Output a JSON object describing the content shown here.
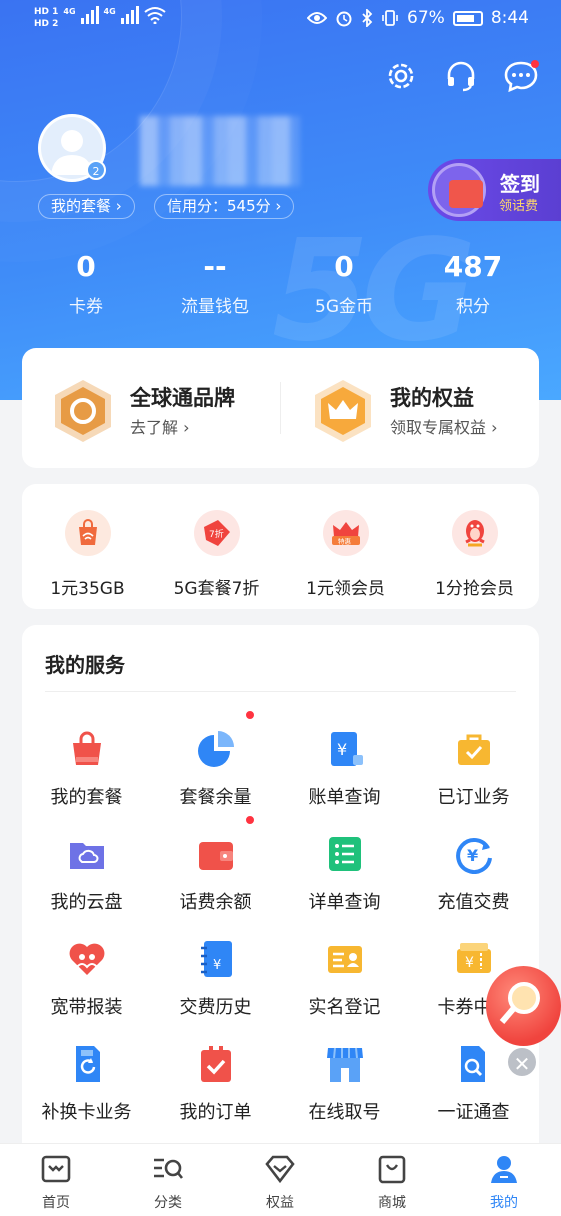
{
  "status_bar": {
    "hd1": "HD 1",
    "hd2": "HD 2",
    "net1": "4G",
    "net2": "4G",
    "battery": "67%",
    "time": "8:44"
  },
  "profile": {
    "level": "2",
    "plan_chip": "我的套餐 ›",
    "credit_chip": "信用分：545分 ›"
  },
  "signin": {
    "title": "签到",
    "subtitle": "领话费"
  },
  "stats": [
    {
      "value": "0",
      "label": "卡券"
    },
    {
      "value": "--",
      "label": "流量钱包"
    },
    {
      "value": "0",
      "label": "5G金币"
    },
    {
      "value": "487",
      "label": "积分"
    }
  ],
  "brand_cards": [
    {
      "title": "全球通品牌",
      "subtitle": "去了解 ›"
    },
    {
      "title": "我的权益",
      "subtitle": "领取专属权益 ›"
    }
  ],
  "promos": [
    {
      "label": "1元35GB",
      "icon": "wifi-bag-icon",
      "badge": ""
    },
    {
      "label": "5G套餐7折",
      "icon": "discount-tag-icon",
      "badge": "7折"
    },
    {
      "label": "1元领会员",
      "icon": "crown-badge-icon",
      "badge": "特惠"
    },
    {
      "label": "1分抢会员",
      "icon": "penguin-icon",
      "badge": ""
    }
  ],
  "services": {
    "title": "我的服务",
    "items": [
      {
        "label": "我的套餐",
        "icon": "bag-icon"
      },
      {
        "label": "套餐余量",
        "icon": "pie-chart-icon"
      },
      {
        "label": "账单查询",
        "icon": "bill-icon"
      },
      {
        "label": "已订业务",
        "icon": "briefcase-check-icon"
      },
      {
        "label": "我的云盘",
        "icon": "cloud-folder-icon"
      },
      {
        "label": "话费余额",
        "icon": "wallet-icon"
      },
      {
        "label": "详单查询",
        "icon": "list-icon"
      },
      {
        "label": "充值交费",
        "icon": "yuan-refresh-icon"
      },
      {
        "label": "宽带报装",
        "icon": "heart-people-icon"
      },
      {
        "label": "交费历史",
        "icon": "notebook-yuan-icon"
      },
      {
        "label": "实名登记",
        "icon": "id-card-icon"
      },
      {
        "label": "卡券中心",
        "icon": "ticket-icon"
      },
      {
        "label": "补换卡业务",
        "icon": "sim-refresh-icon"
      },
      {
        "label": "我的订单",
        "icon": "clipboard-check-icon"
      },
      {
        "label": "在线取号",
        "icon": "store-icon"
      },
      {
        "label": "一证通查",
        "icon": "sim-search-icon"
      }
    ]
  },
  "tabs": [
    {
      "label": "首页",
      "icon": "home-icon"
    },
    {
      "label": "分类",
      "icon": "category-icon"
    },
    {
      "label": "权益",
      "icon": "diamond-icon"
    },
    {
      "label": "商城",
      "icon": "shopping-bag-icon"
    },
    {
      "label": "我的",
      "icon": "person-icon",
      "active": true
    }
  ],
  "colors": {
    "accent": "#3f87f7",
    "red_dot": "#ff3340",
    "active_tab": "#2f86f6"
  }
}
